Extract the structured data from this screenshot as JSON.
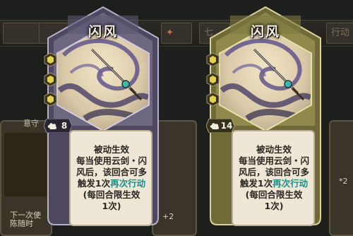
{
  "background": {
    "top_slots": [
      "七",
      "行动"
    ],
    "card_labels": [
      "意守",
      "下一次使",
      "陈随时"
    ],
    "right_fragments": [
      "+2",
      "*2"
    ]
  },
  "cards": [
    {
      "title": "闪风",
      "cost": "8",
      "frame_theme": "purple",
      "effect_header": "被动生效",
      "effect_line1": "每当使用云剑・闪",
      "effect_line2": "风后，该回合可多",
      "effect_line3_prefix": "触发1次",
      "effect_keyword": "再次行动",
      "effect_line4": "(每回合限生效",
      "effect_line5": "1次)"
    },
    {
      "title": "闪风",
      "cost": "14",
      "frame_theme": "gold",
      "effect_header": "被动生效",
      "effect_line1": "每当使用云剑・闪",
      "effect_line2": "风后，该回合可多",
      "effect_line3_prefix": "触发1次",
      "effect_keyword": "再次行动",
      "effect_line4": "(每回合限生效",
      "effect_line5": "1次)"
    }
  ],
  "colors": {
    "purple_frame": "#6e6780",
    "purple_border": "#b7b0c8",
    "gold_frame": "#8f8a4c",
    "gold_border": "#d9d39a",
    "gem_yellow": "#e2cf4a",
    "keyword": "#1f8d8a"
  },
  "icons": [
    "hexagon-gem-icon",
    "qi-cloud-icon",
    "sword-art-icon"
  ]
}
